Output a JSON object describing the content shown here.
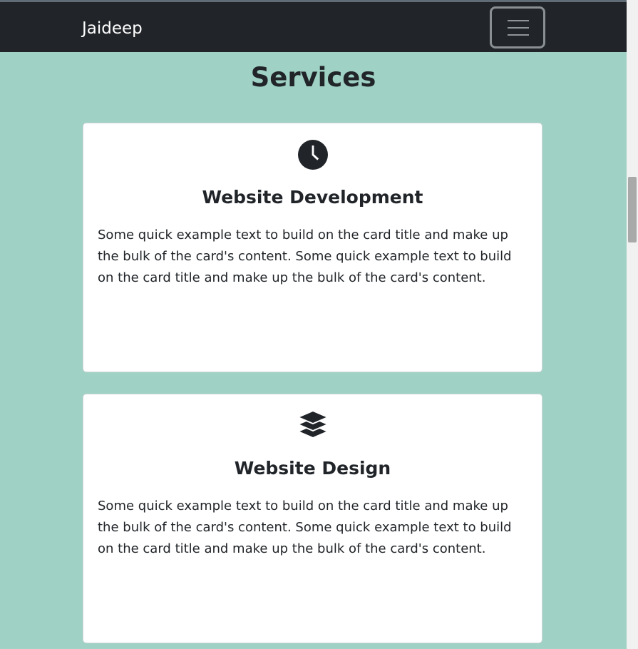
{
  "navbar": {
    "brand": "Jaideep",
    "toggler_icon": "hamburger-menu-icon"
  },
  "services": {
    "title": "Services",
    "cards": [
      {
        "icon": "clock-icon",
        "title": "Website Development",
        "text": "Some quick example text to build on the card title and make up the bulk of the card's content. Some quick example text to build on the card title and make up the bulk of the card's content."
      },
      {
        "icon": "layers-icon",
        "title": "Website Design",
        "text": "Some quick example text to build on the card title and make up the bulk of the card's content. Some quick example text to build on the card title and make up the bulk of the card's content."
      }
    ]
  },
  "colors": {
    "navbar_bg": "#212529",
    "page_bg": "#9fd1c4",
    "card_bg": "#ffffff",
    "text": "#212529"
  }
}
